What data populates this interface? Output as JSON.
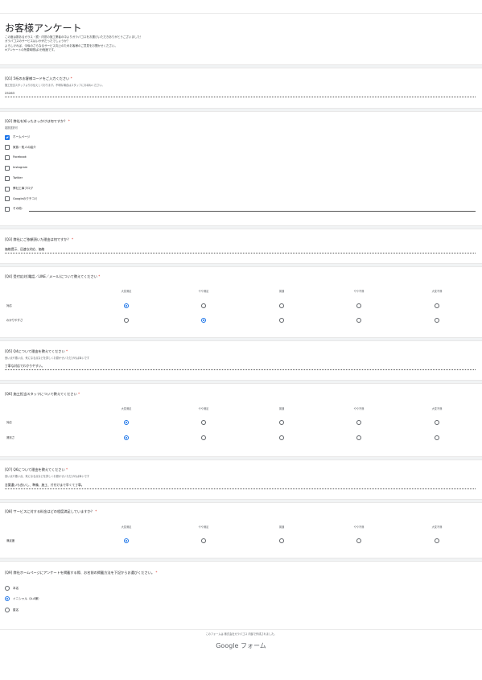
{
  "form": {
    "title": "お客様アンケート",
    "intro": [
      "この度は数あるガラス・鏡・内窓の施工業者の中よりガラパゴスをお選びいただきありがとうございました！",
      "ガラパゴスのサービスはいかがだったでしょうか？",
      "よろしければ、今後のさらなるサービス向上のためお客様のご意見をお聞かせください。",
      "※アンケートの所要時間は2分程度です。"
    ]
  },
  "q1": {
    "title": "[Q1] 5桁のお客様コードをご入力ください",
    "required": "*",
    "help": "施工担当スタッフよりお伝えしております。不明な場合はスタッフにお尋ねください。",
    "answer": "25263"
  },
  "q2": {
    "title": "[Q2] 弊社を知ったきっかけは何ですか？",
    "required": "*",
    "help": "複数選択可",
    "options": [
      {
        "label": "ホームページ",
        "checked": true
      },
      {
        "label": "家族・知人の紹介",
        "checked": false
      },
      {
        "label": "Facebook",
        "checked": false
      },
      {
        "label": "Instagram",
        "checked": false
      },
      {
        "label": "Twitter",
        "checked": false
      },
      {
        "label": "弊社工事ブログ",
        "checked": false
      },
      {
        "label": "Googleのクチコミ",
        "checked": false
      },
      {
        "label": "その他:",
        "checked": false
      }
    ]
  },
  "q3": {
    "title": "[Q3] 弊社にご依頼頂いた理由は何ですか？",
    "required": "*",
    "answer": "価格提示、迅速な対応、価格"
  },
  "q4": {
    "title": "[Q4] 受付応対(電話／LINE／メール)について教えてください",
    "required": "*",
    "columns": [
      "大変満足",
      "やや満足",
      "普通",
      "やや不満",
      "大変不満"
    ],
    "rows": [
      {
        "label": "対応",
        "selected": 0
      },
      {
        "label": "わかりやすさ",
        "selected": 1
      }
    ]
  },
  "q5": {
    "title": "[Q5] Q4について理由を教えてください",
    "required": "*",
    "help": "良い点や悪い点、気になる点などを詳しくお聞かせいただければ幸いです",
    "answer": "丁寧な対応でわかりやすい。"
  },
  "q6": {
    "title": "[Q6] 施工担当スタッフについて教えてください",
    "required": "*",
    "columns": [
      "大変満足",
      "やや満足",
      "普通",
      "やや不満",
      "大変不満"
    ],
    "rows": [
      {
        "label": "対応",
        "selected": 0
      },
      {
        "label": "清潔さ",
        "selected": 0
      }
    ]
  },
  "q7": {
    "title": "[Q7] Q6について理由を教えてください",
    "required": "*",
    "help": "良い点や悪い点、気になる点などを詳しくお聞かせいただければ幸いです",
    "answer": "言葉遣いも良いし、準備、施工、片付けまで早くて丁寧。"
  },
  "q8": {
    "title": "[Q8] サービスに対する料金はどの程度満足していますか？",
    "required": "*",
    "columns": [
      "大変満足",
      "やや満足",
      "普通",
      "やや不満",
      "大変不満"
    ],
    "rows": [
      {
        "label": "満足度",
        "selected": 0
      }
    ]
  },
  "q9": {
    "title": "[Q9] 弊社ホームページにアンケートを掲載する際、お名前の掲載方法を下記からお選びください。",
    "required": "*",
    "options": [
      {
        "label": "本名",
        "selected": false
      },
      {
        "label": "イニシャル（A.A様）",
        "selected": true
      },
      {
        "label": "匿名",
        "selected": false
      }
    ]
  },
  "footer": {
    "note": "このフォームは 株式会社ガラパゴス 内部で作成されました。",
    "brand": "Google フォーム"
  }
}
